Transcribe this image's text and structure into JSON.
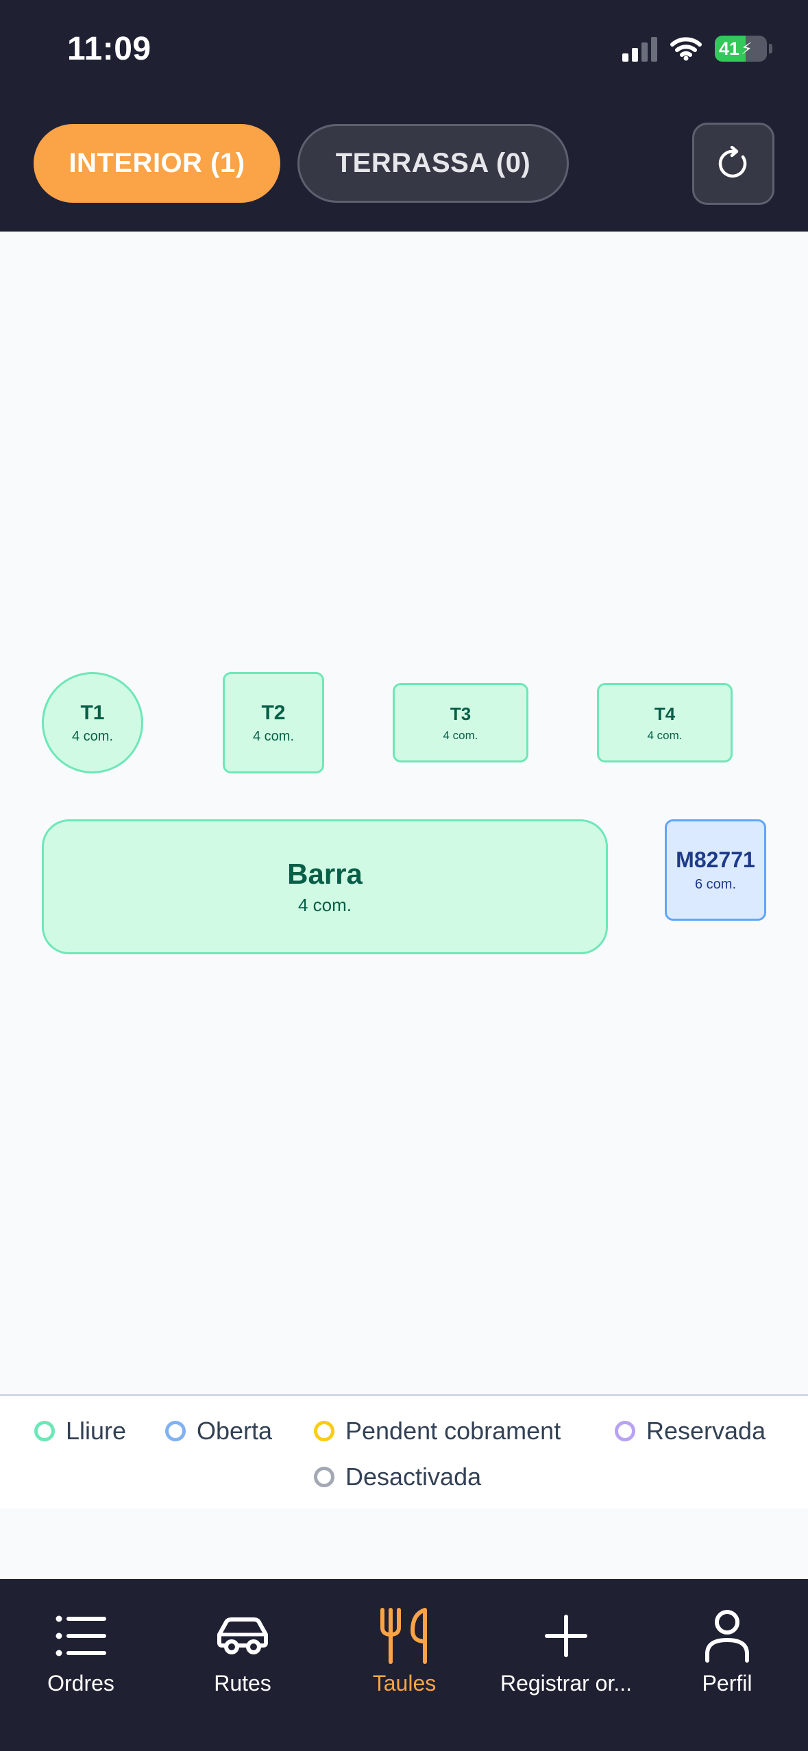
{
  "status_bar": {
    "time": "11:09",
    "battery_percent": "41",
    "battery_level": 0.41
  },
  "zones": [
    {
      "label": "INTERIOR (1)",
      "active": true
    },
    {
      "label": "TERRASSA (0)",
      "active": false
    }
  ],
  "tables": [
    {
      "name": "T1",
      "seats": "4 com.",
      "status": "free",
      "shape": "circle"
    },
    {
      "name": "T2",
      "seats": "4 com.",
      "status": "free",
      "shape": "square"
    },
    {
      "name": "T3",
      "seats": "4 com.",
      "status": "free",
      "shape": "rect"
    },
    {
      "name": "T4",
      "seats": "4 com.",
      "status": "free",
      "shape": "rect"
    },
    {
      "name": "Barra",
      "seats": "4 com.",
      "status": "free",
      "shape": "bar"
    },
    {
      "name": "M82771",
      "seats": "6 com.",
      "status": "open",
      "shape": "square"
    }
  ],
  "legend": [
    {
      "label": "Lliure",
      "color": "#6ee7b7"
    },
    {
      "label": "Oberta",
      "color": "#7fb2f5"
    },
    {
      "label": "Pendent cobrament",
      "color": "#facc15"
    },
    {
      "label": "Reservada",
      "color": "#b8a3f2"
    },
    {
      "label": "Desactivada",
      "color": "#a3a8b3"
    }
  ],
  "nav": [
    {
      "label": "Ordres",
      "icon": "list-icon"
    },
    {
      "label": "Rutes",
      "icon": "car-icon"
    },
    {
      "label": "Taules",
      "icon": "fork-knife-icon",
      "active": true
    },
    {
      "label": "Registrar or...",
      "icon": "plus-icon"
    },
    {
      "label": "Perfil",
      "icon": "user-icon"
    }
  ],
  "colors": {
    "accent": "#fba347",
    "header_bg": "#1f2133",
    "free": "#d1fae5",
    "open": "#dbeafe"
  }
}
